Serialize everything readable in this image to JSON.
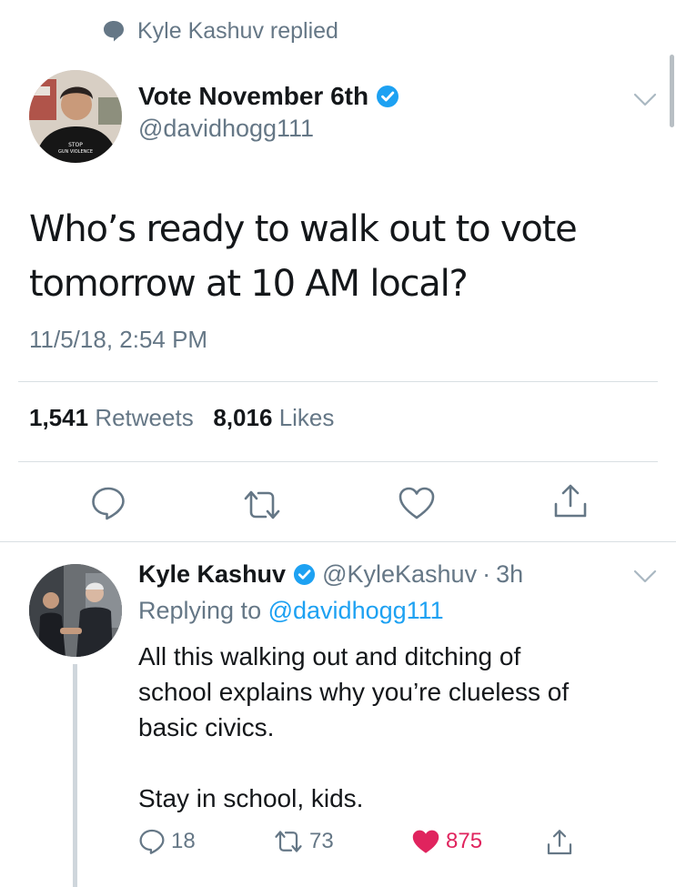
{
  "context": {
    "icon": "speech-bubble-icon",
    "text": "Kyle Kashuv replied"
  },
  "main_tweet": {
    "display_name": "Vote November 6th",
    "verified": true,
    "handle": "@davidhogg111",
    "avatar_shirt_text": "STOP GUN VIOLENCE",
    "text_line1": "Who’s ready to walk out to vote",
    "text_line2": "tomorrow at 10 AM local?",
    "timestamp": "11/5/18, 2:54 PM",
    "retweet_count": "1,541",
    "retweet_label": "Retweets",
    "like_count": "8,016",
    "like_label": "Likes",
    "actions": [
      "reply-icon",
      "retweet-icon",
      "like-icon",
      "share-icon"
    ]
  },
  "reply_tweet": {
    "display_name": "Kyle Kashuv",
    "verified": true,
    "handle": "@KyleKashuv",
    "separator": "·",
    "time": "3h",
    "replying_prefix": "Replying to",
    "replying_to": "@davidhogg111",
    "text_line1": "All this walking out and ditching of",
    "text_line2": "school explains why you’re clueless of",
    "text_line3": "basic civics.",
    "text_line4": "Stay in school, kids.",
    "reply_count": "18",
    "retweet_count": "73",
    "like_count": "875",
    "liked": true
  },
  "colors": {
    "text": "#14171a",
    "secondary": "#657786",
    "link": "#1da1f2",
    "verified": "#1da1f2",
    "liked": "#e0245e",
    "divider": "#d9dfe3"
  }
}
